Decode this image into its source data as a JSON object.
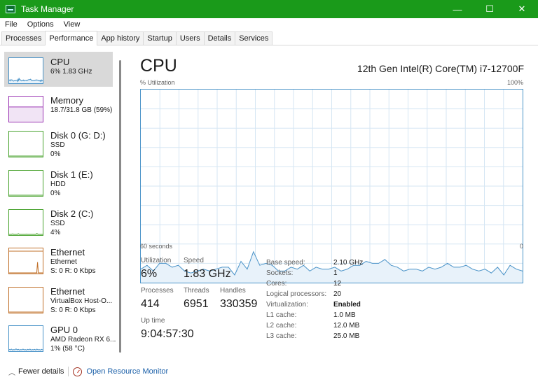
{
  "window": {
    "title": "Task Manager",
    "minimize": "—",
    "maximize": "☐",
    "close": "✕"
  },
  "menu": [
    "File",
    "Options",
    "View"
  ],
  "tabs": [
    {
      "label": "Processes",
      "active": false
    },
    {
      "label": "Performance",
      "active": true
    },
    {
      "label": "App history",
      "active": false
    },
    {
      "label": "Startup",
      "active": false
    },
    {
      "label": "Users",
      "active": false
    },
    {
      "label": "Details",
      "active": false
    },
    {
      "label": "Services",
      "active": false
    }
  ],
  "sidebar": {
    "items": [
      {
        "name": "CPU",
        "sub1": "6% 1.83 GHz",
        "sub2": "",
        "sub3": "",
        "color": "#4a93c8",
        "fill": "#e8f2fa",
        "kind": "cpu"
      },
      {
        "name": "Memory",
        "sub1": "18.7/31.8 GB (59%)",
        "sub2": "",
        "sub3": "",
        "color": "#9b35b3",
        "fill": "#f1e4f5",
        "kind": "memory"
      },
      {
        "name": "Disk 0 (G: D:)",
        "sub1": "SSD",
        "sub2": "0%",
        "sub3": "",
        "color": "#4aa32f",
        "fill": "#eaf6e5",
        "kind": "flat"
      },
      {
        "name": "Disk 1 (E:)",
        "sub1": "HDD",
        "sub2": "0%",
        "sub3": "",
        "color": "#4aa32f",
        "fill": "#eaf6e5",
        "kind": "flat"
      },
      {
        "name": "Disk 2 (C:)",
        "sub1": "SSD",
        "sub2": "4%",
        "sub3": "",
        "color": "#4aa32f",
        "fill": "#eaf6e5",
        "kind": "disk2"
      },
      {
        "name": "Ethernet",
        "sub1": "Ethernet",
        "sub2": "S: 0 R: 0 Kbps",
        "sub3": "",
        "color": "#c0702a",
        "fill": "#f8ece0",
        "kind": "eth"
      },
      {
        "name": "Ethernet",
        "sub1": "VirtualBox Host-O...",
        "sub2": "S: 0 R: 0 Kbps",
        "sub3": "",
        "color": "#c0702a",
        "fill": "#f8ece0",
        "kind": "flat"
      },
      {
        "name": "GPU 0",
        "sub1": "AMD Radeon RX 6...",
        "sub2": "1% (58 °C)",
        "sub3": "",
        "color": "#4a93c8",
        "fill": "#e8f2fa",
        "kind": "gpu"
      }
    ]
  },
  "main": {
    "title": "CPU",
    "model": "12th Gen Intel(R) Core(TM) i7-12700F",
    "graph": {
      "ylabel": "% Utilization",
      "ymax_label": "100%",
      "xlabel_left": "60 seconds",
      "xlabel_right": "0",
      "line_color": "#4a93c8",
      "fill_color": "#e8f2fa",
      "grid_color": "#d5e6f3"
    },
    "stats": {
      "utilization_label": "Utilization",
      "utilization": "6%",
      "speed_label": "Speed",
      "speed": "1.83 GHz",
      "processes_label": "Processes",
      "processes": "414",
      "threads_label": "Threads",
      "threads": "6951",
      "handles_label": "Handles",
      "handles": "330359",
      "uptime_label": "Up time",
      "uptime": "9:04:57:30"
    },
    "specs": [
      {
        "key": "Base speed:",
        "value": "2.10 GHz"
      },
      {
        "key": "Sockets:",
        "value": "1"
      },
      {
        "key": "Cores:",
        "value": "12"
      },
      {
        "key": "Logical processors:",
        "value": "20"
      },
      {
        "key": "Virtualization:",
        "value": "Enabled"
      },
      {
        "key": "L1 cache:",
        "value": "1.0 MB"
      },
      {
        "key": "L2 cache:",
        "value": "12.0 MB"
      },
      {
        "key": "L3 cache:",
        "value": "25.0 MB"
      }
    ]
  },
  "cpu_history": [
    7,
    9,
    6,
    10,
    10,
    8,
    9,
    6,
    5,
    6,
    7,
    6,
    7,
    8,
    8,
    4,
    11,
    7,
    16,
    9,
    10,
    9,
    6,
    6,
    8,
    7,
    9,
    6,
    8,
    7,
    7,
    8,
    6,
    7,
    9,
    9,
    11,
    10,
    10,
    12,
    9,
    8,
    6,
    7,
    7,
    6,
    8,
    7,
    8,
    10,
    8,
    8,
    9,
    7,
    6,
    7,
    5,
    8,
    4,
    9,
    7,
    6
  ],
  "footer": {
    "fewer_details": "Fewer details",
    "open_rm": "Open Resource Monitor"
  }
}
